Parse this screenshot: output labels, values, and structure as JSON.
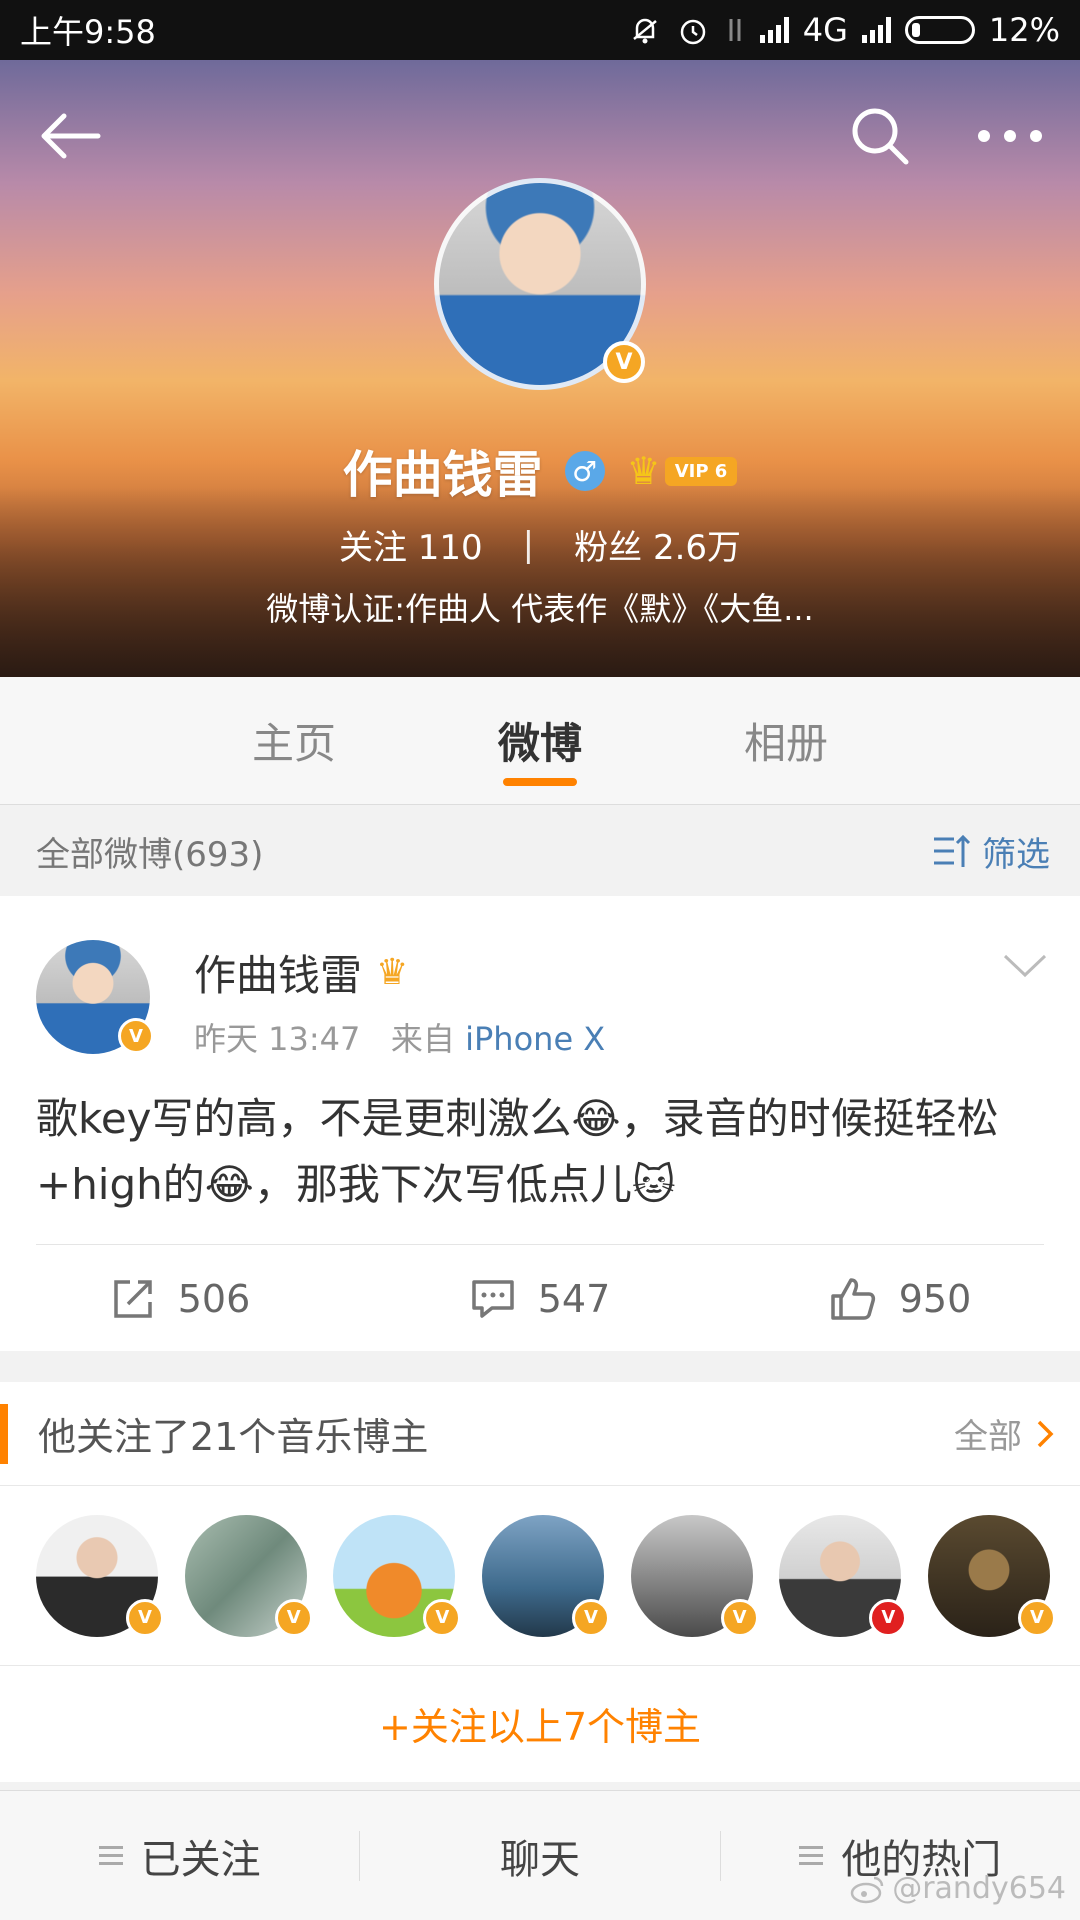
{
  "status_bar": {
    "time": "上午9:58",
    "network": "4G",
    "battery": "12%"
  },
  "profile": {
    "name": "作曲钱雷",
    "verified_badge": "V",
    "gender_symbol": "♂",
    "vip_label": "VIP 6",
    "following_label": "关注",
    "following_count": "110",
    "fans_label": "粉丝",
    "fans_count": "2.6万",
    "separator": "|",
    "verification": "微博认证:作曲人  代表作《默》《大鱼..."
  },
  "tabs": [
    {
      "label": "主页",
      "active": false
    },
    {
      "label": "微博",
      "active": true
    },
    {
      "label": "相册",
      "active": false
    }
  ],
  "filter": {
    "count_label": "全部微博(693)",
    "filter_label": "筛选"
  },
  "post": {
    "author": "作曲钱雷",
    "time": "昨天 13:47",
    "from_label": "来自",
    "source": "iPhone X",
    "text": "歌key写的高，不是更刺激么😂，录音的时候挺轻松+high的😂，那我下次写低点儿🐱",
    "reposts": "506",
    "comments": "547",
    "likes": "950"
  },
  "follow_section": {
    "title": "他关注了21个音乐博主",
    "all_label": "全部",
    "follow_all_label": "+关注以上7个博主",
    "bloggers": [
      {
        "badge": "V",
        "color": "#2b2b2b"
      },
      {
        "badge": "V",
        "color": "#7f9a8c"
      },
      {
        "badge": "V",
        "color": "#f08a2a"
      },
      {
        "badge": "V",
        "color": "#3e6a8c"
      },
      {
        "badge": "V",
        "color": "#6d6d6d"
      },
      {
        "badge": "V",
        "color": "#4a4a4a"
      },
      {
        "badge": "V",
        "color": "#3a3020"
      }
    ]
  },
  "bottom_bar": {
    "followed": "已关注",
    "chat": "聊天",
    "hot": "他的热门"
  },
  "watermark": "@randy654",
  "colors": {
    "accent": "#ff8200",
    "link": "#4a7fb5",
    "verified": "#f5a623"
  }
}
